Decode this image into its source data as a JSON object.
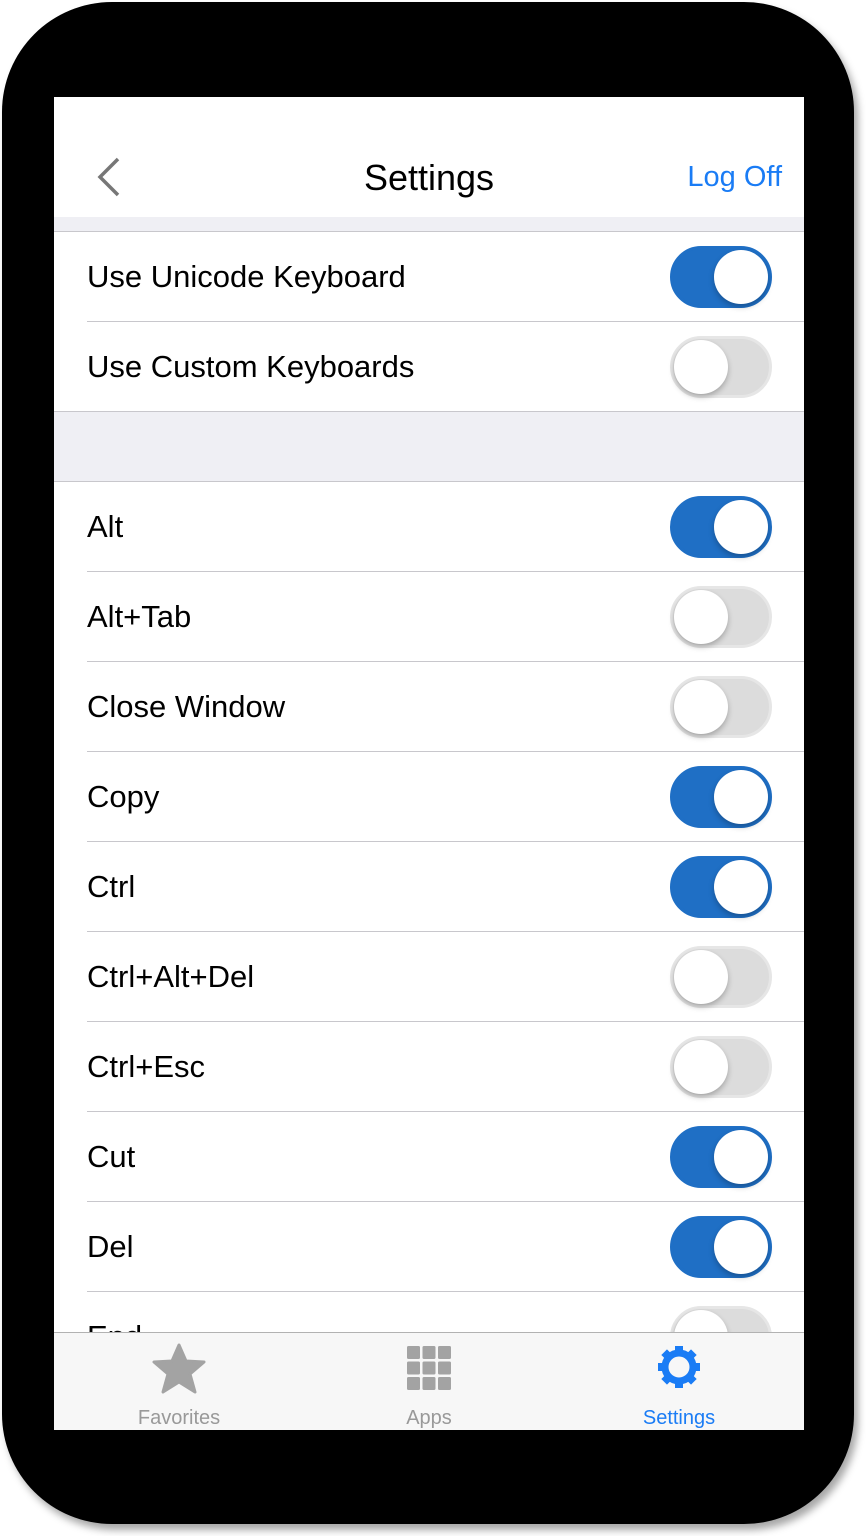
{
  "header": {
    "title": "Settings",
    "logoff_label": "Log Off"
  },
  "section1": [
    {
      "label": "Use Unicode Keyboard",
      "on": true
    },
    {
      "label": "Use Custom Keyboards",
      "on": false
    }
  ],
  "section2": [
    {
      "label": "Alt",
      "on": true
    },
    {
      "label": "Alt+Tab",
      "on": false
    },
    {
      "label": "Close Window",
      "on": false
    },
    {
      "label": "Copy",
      "on": true
    },
    {
      "label": "Ctrl",
      "on": true
    },
    {
      "label": "Ctrl+Alt+Del",
      "on": false
    },
    {
      "label": "Ctrl+Esc",
      "on": false
    },
    {
      "label": "Cut",
      "on": true
    },
    {
      "label": "Del",
      "on": true
    },
    {
      "label": "End",
      "on": false
    }
  ],
  "tabbar": {
    "items": [
      {
        "label": "Favorites",
        "icon": "star-icon",
        "active": false
      },
      {
        "label": "Apps",
        "icon": "grid-icon",
        "active": false
      },
      {
        "label": "Settings",
        "icon": "gear-icon",
        "active": true
      }
    ]
  },
  "colors": {
    "accent": "#1a7cf5",
    "toggle_on": "#1f6fc5",
    "toggle_off": "#dcdcdc"
  }
}
